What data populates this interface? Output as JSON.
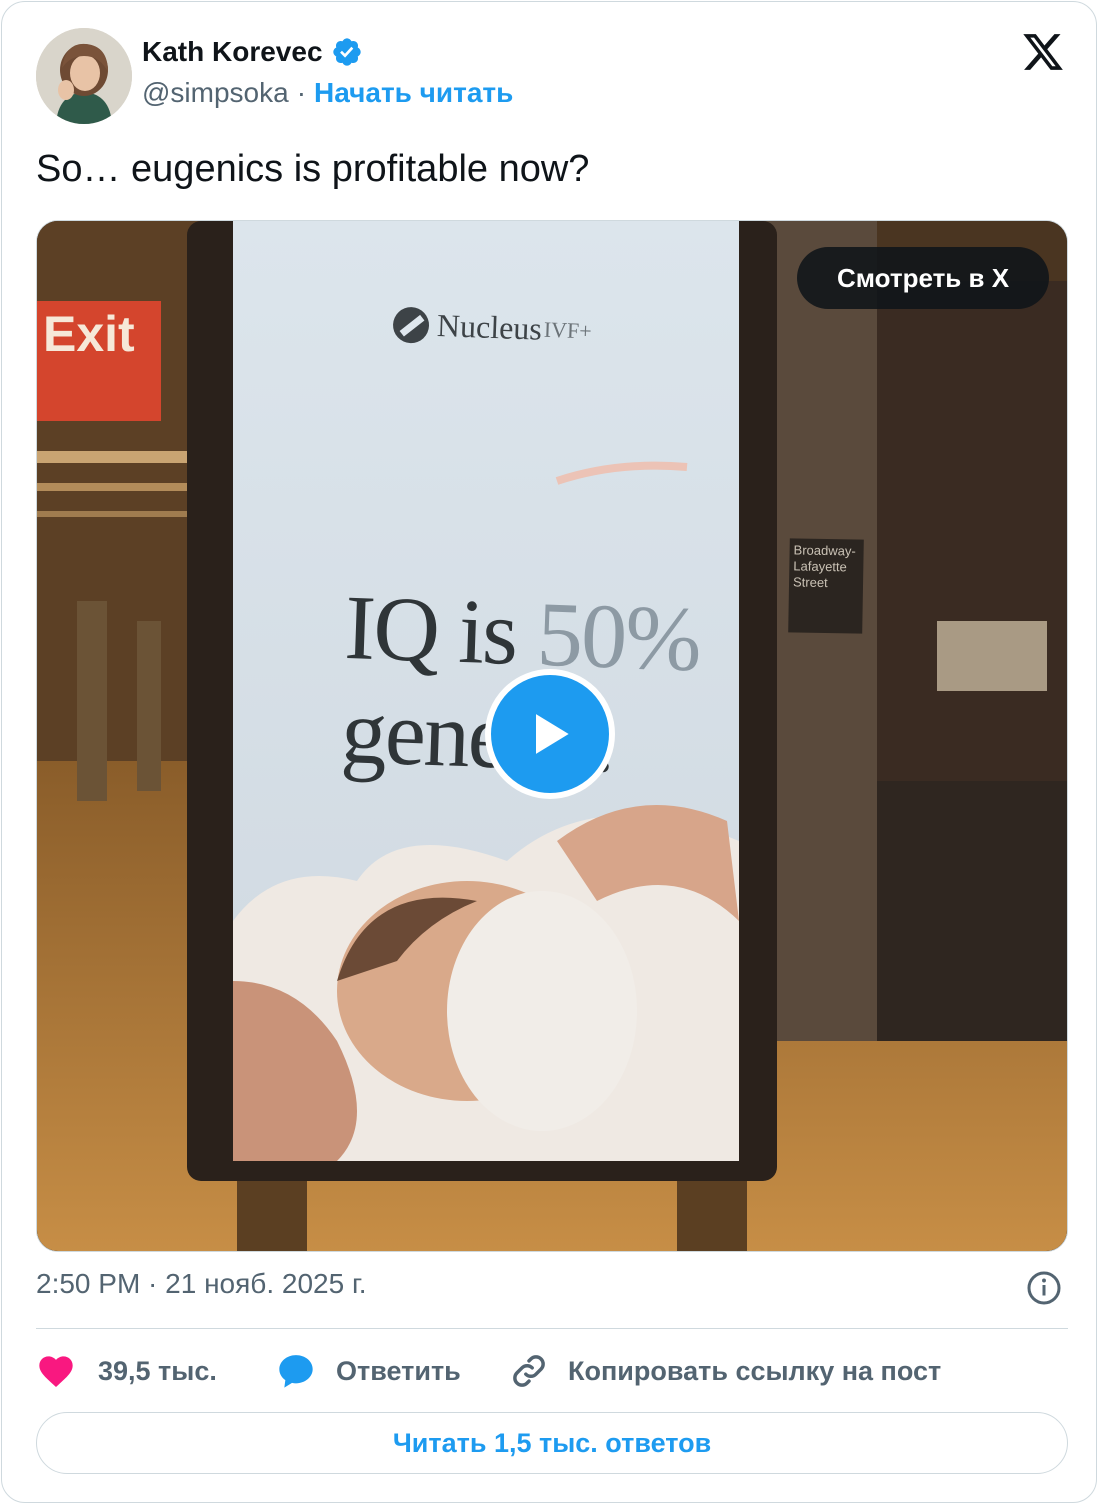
{
  "author": {
    "name": "Kath Korevec",
    "handle": "@simpsoka",
    "separator": "·",
    "follow_label": "Начать читать"
  },
  "tweet": {
    "text": "So… eugenics is profitable now?"
  },
  "media": {
    "watch_label": "Смотреть в X",
    "ad_brand": "Nucleus",
    "ad_brand_suffix": "IVF+",
    "ad_headline_line1_a": "IQ is ",
    "ad_headline_line1_b": "50%",
    "ad_headline_line2": "genetic.",
    "exit_sign": "Exit",
    "station_sign": "Broadway-Lafayette Street"
  },
  "meta": {
    "timestamp": "2:50 PM · 21 нояб. 2025 г."
  },
  "actions": {
    "likes": "39,5 тыс.",
    "reply_label": "Ответить",
    "copy_link_label": "Копировать ссылку на пост"
  },
  "footer": {
    "read_replies_label": "Читать 1,5 тыс. ответов"
  },
  "colors": {
    "accent": "#1d9bf0",
    "like": "#f91880",
    "text": "#0f1419",
    "muted": "#536471",
    "border": "#cfd9de"
  },
  "icons": [
    "verified-badge-icon",
    "x-logo-icon",
    "play-icon",
    "info-icon",
    "heart-icon",
    "reply-bubble-icon",
    "link-icon"
  ]
}
